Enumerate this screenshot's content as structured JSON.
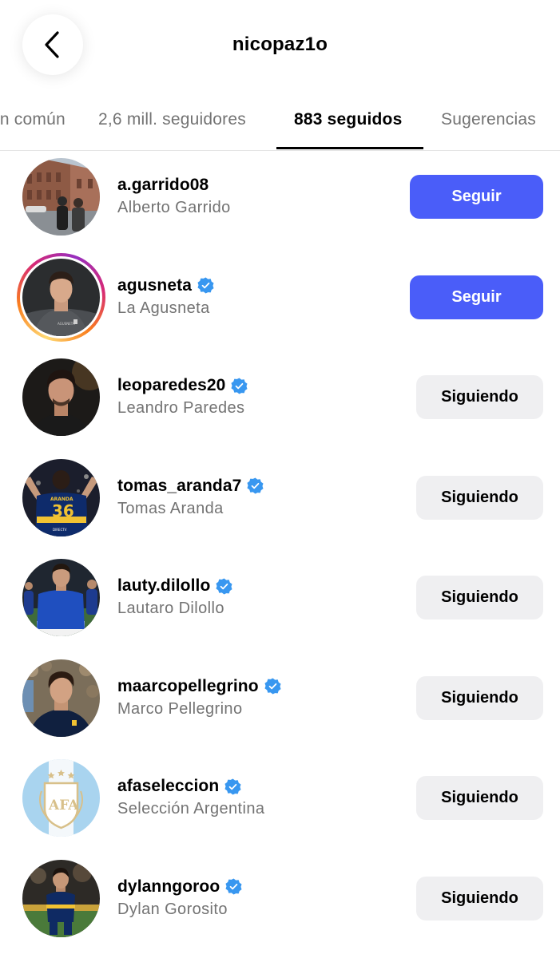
{
  "header": {
    "title": "nicopaz1o",
    "back_icon": "chevron-left-icon"
  },
  "tabs": [
    {
      "label": "en común",
      "active": false
    },
    {
      "label": "2,6 mill. seguidores",
      "active": false
    },
    {
      "label": "883 seguidos",
      "active": true
    },
    {
      "label": "Sugerencias",
      "active": false
    }
  ],
  "colors": {
    "accent": "#4a5df9",
    "verified": "#3897f0",
    "secondary_text": "#737373",
    "following_button": "#efeff1"
  },
  "users": [
    {
      "username": "a.garrido08",
      "full_name": "Alberto Garrido",
      "verified": false,
      "button": "Seguir"
    },
    {
      "username": "agusneta",
      "full_name": "La Agusneta",
      "verified": true,
      "button": "Seguir"
    },
    {
      "username": "leoparedes20",
      "full_name": "Leandro Paredes",
      "verified": true,
      "button": "Siguiendo"
    },
    {
      "username": "tomas_aranda7",
      "full_name": "Tomas Aranda",
      "verified": true,
      "button": "Siguiendo"
    },
    {
      "username": "lauty.dilollo",
      "full_name": "Lautaro Dilollo",
      "verified": true,
      "button": "Siguiendo"
    },
    {
      "username": "maarcopellegrino",
      "full_name": "Marco Pellegrino",
      "verified": true,
      "button": "Siguiendo"
    },
    {
      "username": "afaseleccion",
      "full_name": "Selección Argentina",
      "verified": true,
      "button": "Siguiendo"
    },
    {
      "username": "dylanngoroo",
      "full_name": "Dylan Gorosito",
      "verified": true,
      "button": "Siguiendo"
    }
  ],
  "avatar_photos": {
    "agusneta_jersey": "AGUSNETA",
    "tomas_aranda_jersey_name": "ARANDA",
    "tomas_aranda_jersey_number": "36",
    "tomas_aranda_sponsor": "DIRECTV",
    "afa_crest": "AFA"
  }
}
